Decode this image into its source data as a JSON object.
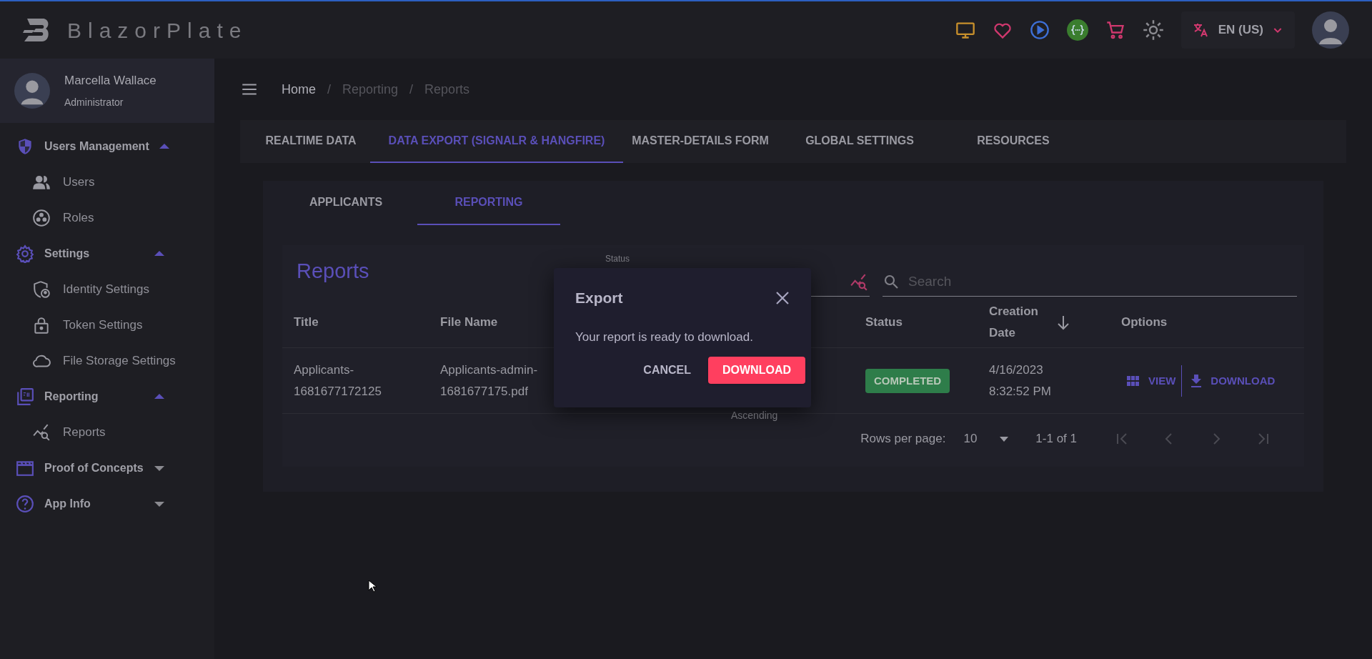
{
  "app": {
    "logo_text": "BlazorPlate",
    "language": "EN (US)"
  },
  "user": {
    "name": "Marcella Wallace",
    "role": "Administrator"
  },
  "nav": [
    {
      "label": "Users Management",
      "expanded": true,
      "children": [
        {
          "label": "Users"
        },
        {
          "label": "Roles"
        }
      ]
    },
    {
      "label": "Settings",
      "expanded": true,
      "children": [
        {
          "label": "Identity Settings"
        },
        {
          "label": "Token Settings"
        },
        {
          "label": "File Storage Settings"
        }
      ]
    },
    {
      "label": "Reporting",
      "expanded": true,
      "children": [
        {
          "label": "Reports"
        }
      ]
    },
    {
      "label": "Proof of Concepts",
      "expanded": false
    },
    {
      "label": "App Info",
      "expanded": false
    }
  ],
  "breadcrumb_separator": "/",
  "breadcrumb": [
    {
      "label": "Home",
      "disabled": false
    },
    {
      "label": "Reporting",
      "disabled": true
    },
    {
      "label": "Reports",
      "disabled": true
    }
  ],
  "tabs": [
    {
      "label": "REALTIME DATA",
      "selected": false
    },
    {
      "label": "DATA EXPORT (SIGNALR & HANGFIRE)",
      "selected": true
    },
    {
      "label": "MASTER-DETAILS FORM",
      "selected": false
    },
    {
      "label": "GLOBAL SETTINGS",
      "selected": false
    },
    {
      "label": "RESOURCES",
      "selected": false
    }
  ],
  "subtabs": [
    {
      "label": "APPLICANTS",
      "selected": false
    },
    {
      "label": "REPORTING",
      "selected": true
    }
  ],
  "reports": {
    "title": "Reports",
    "status_filter": {
      "label": "Status"
    },
    "search": {
      "placeholder": "Search"
    },
    "columns": [
      "Title",
      "File Name",
      "Status",
      "Creation Date",
      "Options"
    ],
    "rows": [
      {
        "title": "Applicants-1681677172125",
        "file_name": "Applicants-admin-1681677175.pdf",
        "status": "COMPLETED",
        "creation_date": "4/16/2023 8:32:52 PM",
        "actions": [
          "VIEW",
          "DOWNLOAD"
        ]
      }
    ],
    "tooltip": "Ascending",
    "pagination": {
      "rows_per_page_label": "Rows per page:",
      "rows_per_page": "10",
      "range": "1-1 of 1"
    }
  },
  "dialog": {
    "title": "Export",
    "message": "Your report is ready to download.",
    "buttons": [
      {
        "kind": "text",
        "label": "CANCEL"
      },
      {
        "kind": "primary",
        "label": "DOWNLOAD"
      }
    ]
  }
}
